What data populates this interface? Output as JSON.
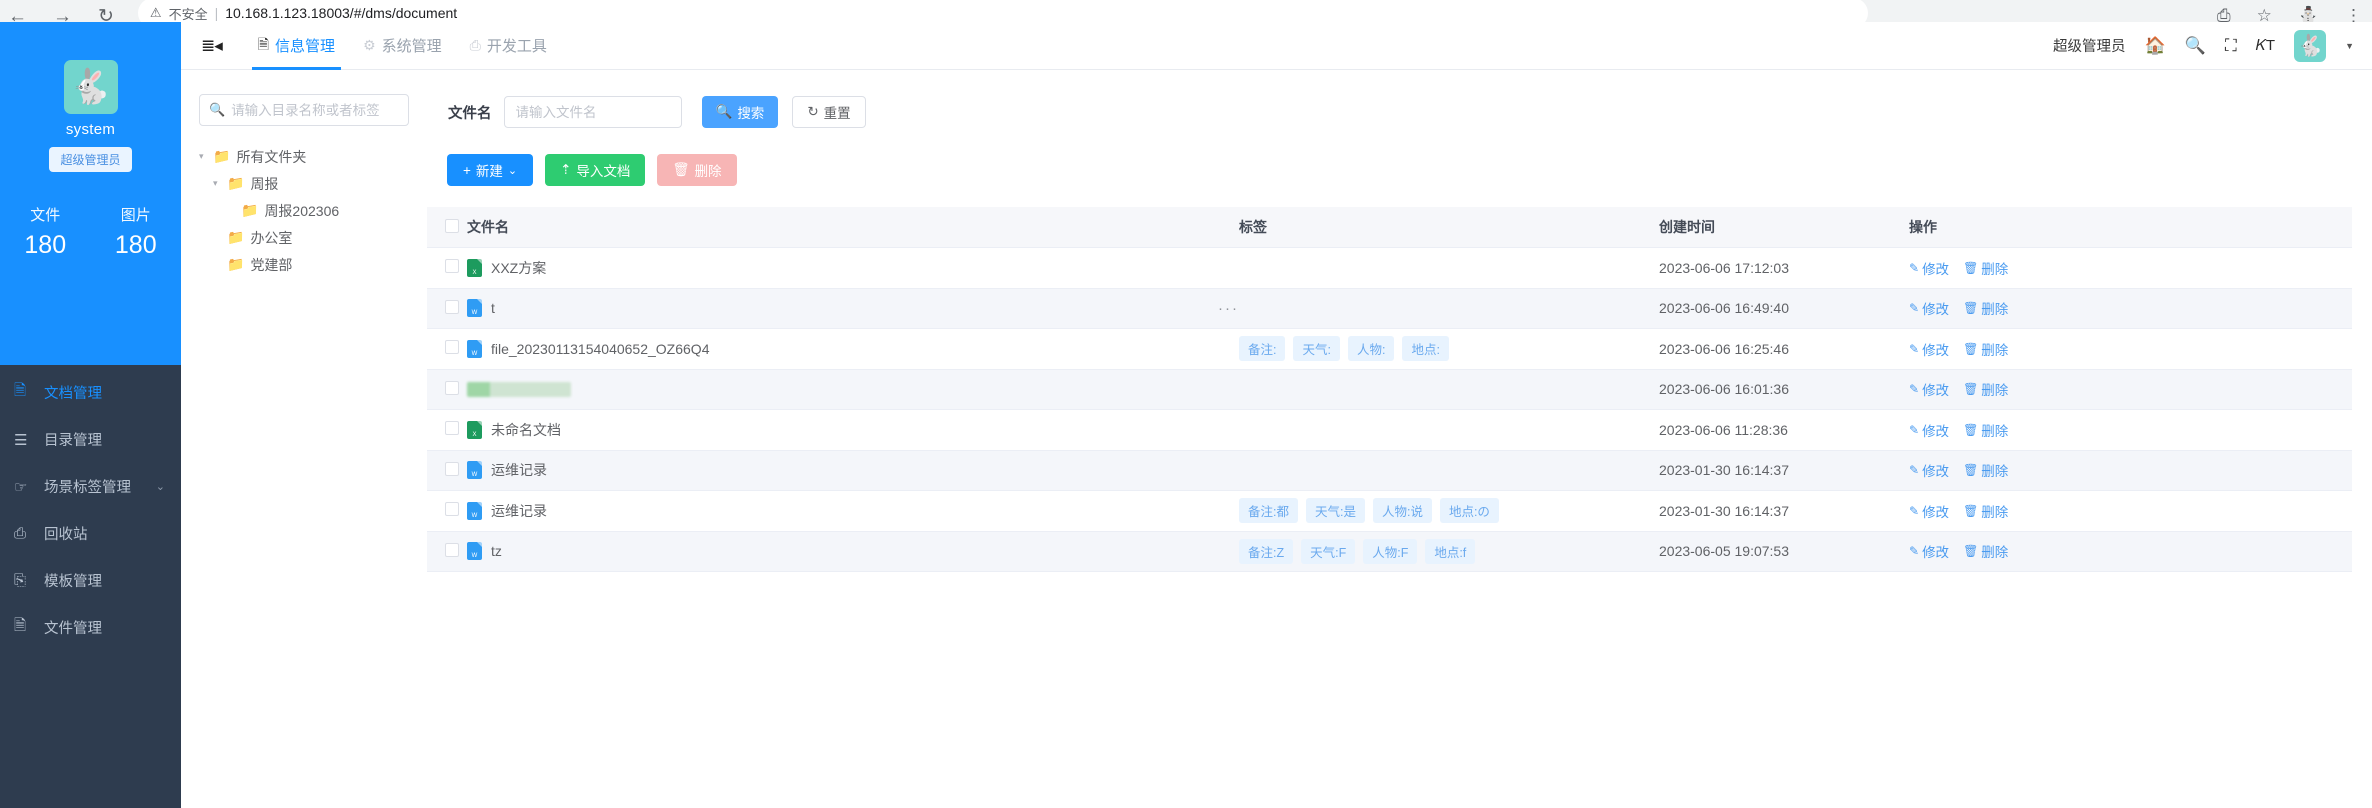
{
  "browser": {
    "back_icon": "back-arrow-icon",
    "forward_icon": "forward-arrow-icon",
    "reload_icon": "reload-icon",
    "security_label": "不安全",
    "separator": "|",
    "url": "10.168.1.123.18003/#/dms/document",
    "share_icon": "share-icon",
    "bookmark_icon": "star-icon",
    "profile_icon": "profile-icon",
    "menu_icon": "more-menu-icon"
  },
  "colors": {
    "brand_blue": "#1890ff",
    "sidebar_dark": "#2e3c4f",
    "success_green": "#2ecc71",
    "danger_pink": "#f7b5b5",
    "avatar_teal": "#72d5cd",
    "tag_bg": "#e8f3fe",
    "tag_text": "#6aa9ee"
  },
  "sidebar": {
    "profile": {
      "avatar_icon": "bunny-avatar",
      "name": "system",
      "role_badge": "超级管理员"
    },
    "stats": [
      {
        "label": "文件",
        "value": "180"
      },
      {
        "label": "图片",
        "value": "180"
      }
    ],
    "items": [
      {
        "label": "文档管理",
        "icon": "document-icon",
        "active": true,
        "arrow": ""
      },
      {
        "label": "目录管理",
        "icon": "list-icon",
        "active": false,
        "arrow": ""
      },
      {
        "label": "场景标签管理",
        "icon": "tag-hand-icon",
        "active": false,
        "arrow": "⌄"
      },
      {
        "label": "回收站",
        "icon": "recycle-bin-icon",
        "active": false,
        "arrow": ""
      },
      {
        "label": "模板管理",
        "icon": "template-icon",
        "active": false,
        "arrow": ""
      },
      {
        "label": "文件管理",
        "icon": "folder-file-icon",
        "active": false,
        "arrow": ""
      }
    ]
  },
  "header": {
    "collapse_icon": "collapse-sidebar-icon",
    "tabs": [
      {
        "label": "信息管理",
        "icon": "document-icon",
        "active": true
      },
      {
        "label": "系统管理",
        "icon": "gear-icon",
        "active": false
      },
      {
        "label": "开发工具",
        "icon": "toolbox-icon",
        "active": false
      }
    ],
    "user_role": "超级管理员",
    "icons": {
      "home": "home-icon",
      "search": "search-icon",
      "fullscreen": "fullscreen-icon",
      "font_size": "font-size-icon",
      "avatar": "bunny-avatar",
      "caret": "chevron-down-icon"
    }
  },
  "tree_panel": {
    "search_placeholder": "请输入目录名称或者标签",
    "search_value": "",
    "search_icon": "search-icon",
    "nodes": [
      {
        "label": "所有文件夹",
        "depth": 0,
        "arrow": "▾",
        "folder_icon": "folder-icon"
      },
      {
        "label": "周报",
        "depth": 1,
        "arrow": "▾",
        "folder_icon": "folder-icon"
      },
      {
        "label": "周报202306",
        "depth": 2,
        "arrow": "",
        "folder_icon": "folder-icon"
      },
      {
        "label": "办公室",
        "depth": 1,
        "arrow": "",
        "folder_icon": "folder-icon"
      },
      {
        "label": "党建部",
        "depth": 1,
        "arrow": "",
        "folder_icon": "folder-icon"
      }
    ]
  },
  "toolbar": {
    "filename_label": "文件名",
    "filename_placeholder": "请输入文件名",
    "filename_value": "",
    "search_button": "搜索",
    "search_icon": "search-icon",
    "reset_button": "重置",
    "reset_icon": "refresh-icon",
    "new_button": "新建",
    "new_icon": "plus-icon",
    "new_caret": "⌄",
    "import_button": "导入文档",
    "import_icon": "upload-icon",
    "delete_button": "删除",
    "delete_icon": "trash-icon"
  },
  "table": {
    "columns": [
      "文件名",
      "标签",
      "创建时间",
      "操作"
    ],
    "select_all_checkbox": false,
    "op_edit_label": "修改",
    "op_edit_icon": "pencil-icon",
    "op_delete_label": "删除",
    "op_delete_icon": "trash-icon",
    "rows": [
      {
        "name": "XXZ方案",
        "file_type": "xls",
        "redacted": false,
        "tags": [],
        "extra": "",
        "time": "2023-06-06 17:12:03",
        "highlight": false
      },
      {
        "name": "t",
        "file_type": "doc",
        "redacted": false,
        "tags": [],
        "extra": "···",
        "time": "2023-06-06 16:49:40",
        "highlight": true
      },
      {
        "name": "file_20230113154040652_OZ66Q4",
        "file_type": "doc",
        "redacted": false,
        "tags": [
          "备注:",
          "天气:",
          "人物:",
          "地点:"
        ],
        "extra": "",
        "time": "2023-06-06 16:25:46",
        "highlight": false
      },
      {
        "name": "",
        "file_type": "xls",
        "redacted": true,
        "tags": [],
        "extra": "",
        "time": "2023-06-06 16:01:36",
        "highlight": true
      },
      {
        "name": "未命名文档",
        "file_type": "xls",
        "redacted": false,
        "tags": [],
        "extra": "",
        "time": "2023-06-06 11:28:36",
        "highlight": false
      },
      {
        "name": "运维记录",
        "file_type": "doc",
        "redacted": false,
        "tags": [],
        "extra": "",
        "time": "2023-01-30 16:14:37",
        "highlight": true
      },
      {
        "name": "运维记录",
        "file_type": "doc",
        "redacted": false,
        "tags": [
          "备注:都",
          "天气:是",
          "人物:说",
          "地点:の"
        ],
        "extra": "",
        "time": "2023-01-30 16:14:37",
        "highlight": false
      },
      {
        "name": "tz",
        "file_type": "doc",
        "redacted": false,
        "tags": [
          "备注:Z",
          "天气:F",
          "人物:F",
          "地点:f"
        ],
        "extra": "",
        "time": "2023-06-05 19:07:53",
        "highlight": true
      }
    ]
  }
}
